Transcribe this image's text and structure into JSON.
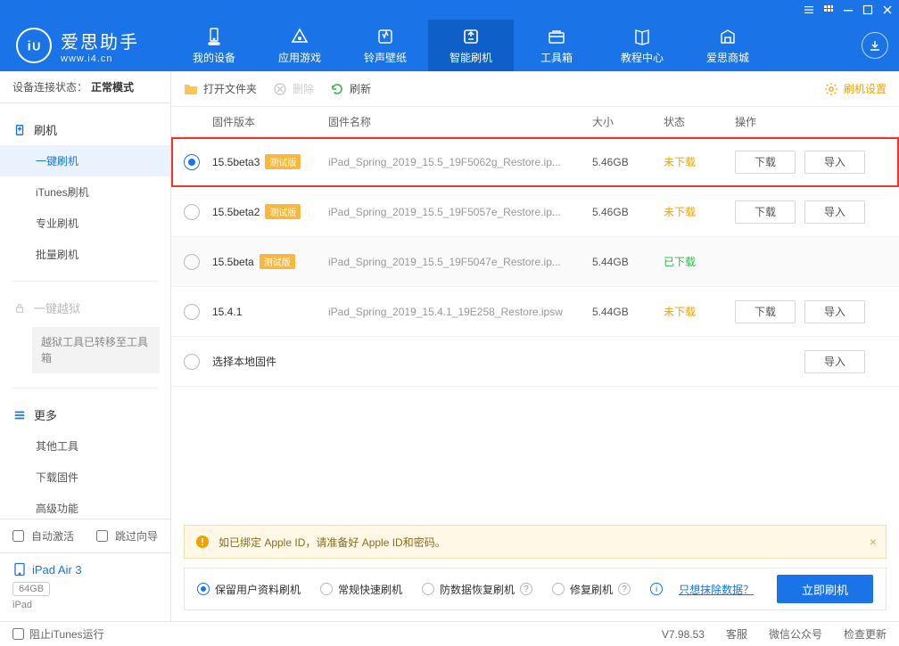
{
  "brand": {
    "name": "爱思助手",
    "site": "www.i4.cn"
  },
  "topnav": [
    {
      "label": "我的设备"
    },
    {
      "label": "应用游戏"
    },
    {
      "label": "铃声壁纸"
    },
    {
      "label": "智能刷机"
    },
    {
      "label": "工具箱"
    },
    {
      "label": "教程中心"
    },
    {
      "label": "爱思商城"
    }
  ],
  "connection": {
    "prefix": "设备连接状态：",
    "mode": "正常模式"
  },
  "sidebar": {
    "groups": [
      {
        "head": "刷机",
        "items": [
          "一键刷机",
          "iTunes刷机",
          "专业刷机",
          "批量刷机"
        ]
      },
      {
        "head": "一键越狱",
        "locked": true,
        "note": "越狱工具已转移至工具箱"
      },
      {
        "head": "更多",
        "items": [
          "其他工具",
          "下载固件",
          "高级功能"
        ]
      }
    ],
    "auto_activate": "自动激活",
    "skip_guide": "跳过向导"
  },
  "device": {
    "name": "iPad Air 3",
    "storage": "64GB",
    "type": "iPad"
  },
  "toolbar": {
    "open_folder": "打开文件夹",
    "delete": "删除",
    "refresh": "刷新",
    "settings": "刷机设置"
  },
  "table": {
    "headers": {
      "version": "固件版本",
      "name": "固件名称",
      "size": "大小",
      "status": "状态",
      "ops": "操作"
    },
    "download_btn": "下载",
    "import_btn": "导入",
    "local_label": "选择本地固件",
    "rows": [
      {
        "selected": true,
        "version": "15.5beta3",
        "beta": "测试版",
        "name": "iPad_Spring_2019_15.5_19F5062g_Restore.ip...",
        "size": "5.46GB",
        "status": "未下载",
        "status_class": "pending",
        "ops": [
          "download",
          "import"
        ],
        "highlight": true
      },
      {
        "selected": false,
        "version": "15.5beta2",
        "beta": "测试版",
        "name": "iPad_Spring_2019_15.5_19F5057e_Restore.ip...",
        "size": "5.46GB",
        "status": "未下载",
        "status_class": "pending",
        "ops": [
          "download",
          "import"
        ]
      },
      {
        "selected": false,
        "version": "15.5beta",
        "beta": "测试版",
        "name": "iPad_Spring_2019_15.5_19F5047e_Restore.ip...",
        "size": "5.44GB",
        "status": "已下载",
        "status_class": "done",
        "ops": [],
        "alt": true
      },
      {
        "selected": false,
        "version": "15.4.1",
        "beta": "",
        "name": "iPad_Spring_2019_15.4.1_19E258_Restore.ipsw",
        "size": "5.44GB",
        "status": "未下载",
        "status_class": "pending",
        "ops": [
          "download",
          "import"
        ]
      }
    ]
  },
  "notice": "如已绑定 Apple ID，请准备好 Apple ID和密码。",
  "flash_options": {
    "opts": [
      {
        "label": "保留用户资料刷机",
        "checked": true
      },
      {
        "label": "常规快速刷机",
        "checked": false
      },
      {
        "label": "防数据恢复刷机",
        "checked": false,
        "help": true
      },
      {
        "label": "修复刷机",
        "checked": false,
        "help": true
      }
    ],
    "erase_link": "只想抹除数据？",
    "flash_btn": "立即刷机"
  },
  "statusbar": {
    "block_itunes": "阻止iTunes运行",
    "version_label": "V",
    "version": "7.98.53",
    "support": "客服",
    "wechat": "微信公众号",
    "update": "检查更新"
  }
}
